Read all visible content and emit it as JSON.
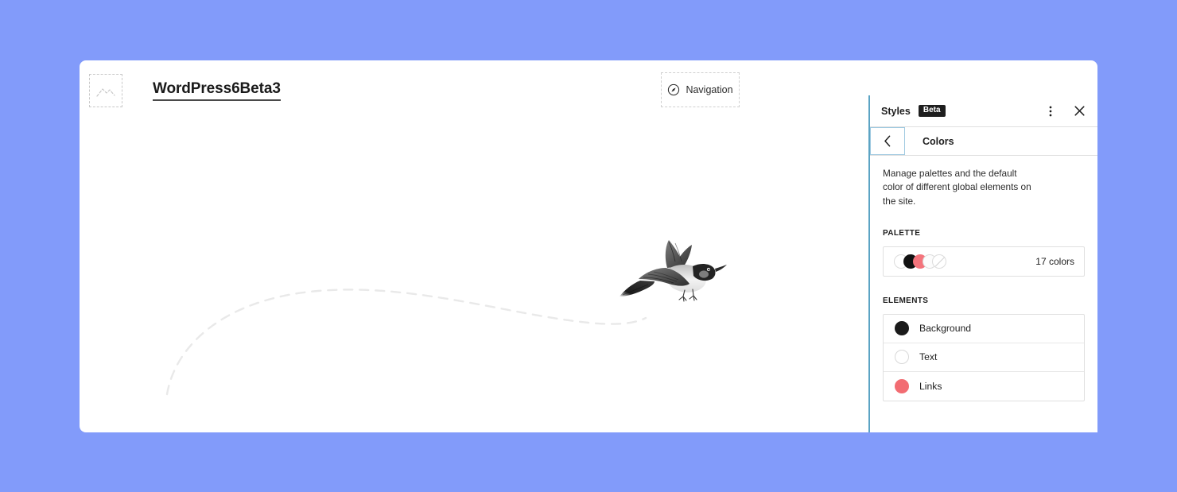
{
  "theme": {
    "app_background": "#829bfa",
    "canvas_background": "#ffffff",
    "accent_border": "#5ba4c4"
  },
  "site": {
    "logo_icon": "image-placeholder-icon",
    "title": "WordPress6Beta3",
    "navigation_block": {
      "icon": "compass-navigation-icon",
      "label": "Navigation"
    },
    "inserter": {
      "icon": "plus-icon",
      "label": "+"
    },
    "illustration": {
      "name": "flying-bird-illustration",
      "path_name": "dashed-flight-path"
    }
  },
  "sidebar": {
    "title": "Styles",
    "badge": "Beta",
    "actions": [
      {
        "name": "more-options-icon",
        "label": "⋮"
      },
      {
        "name": "close-icon",
        "label": "✕"
      }
    ],
    "panel": {
      "back_label": "‹",
      "title": "Colors",
      "description": "Manage palettes and the default color of different global elements on the site."
    },
    "palette": {
      "heading": "PALETTE",
      "count_label": "17 colors",
      "swatches": [
        {
          "name": "swatch-white",
          "color": "#ffffff"
        },
        {
          "name": "swatch-black",
          "color": "#111111"
        },
        {
          "name": "swatch-coral",
          "color": "#f4747c"
        },
        {
          "name": "swatch-offwhite",
          "color": "#fcfcfc"
        },
        {
          "name": "swatch-transparent",
          "color": "transparent"
        }
      ]
    },
    "elements": {
      "heading": "ELEMENTS",
      "items": [
        {
          "name": "element-background",
          "label": "Background",
          "color": "#1a1a1a"
        },
        {
          "name": "element-text",
          "label": "Text",
          "color": "#ffffff"
        },
        {
          "name": "element-links",
          "label": "Links",
          "color": "#f26c72"
        }
      ]
    }
  }
}
